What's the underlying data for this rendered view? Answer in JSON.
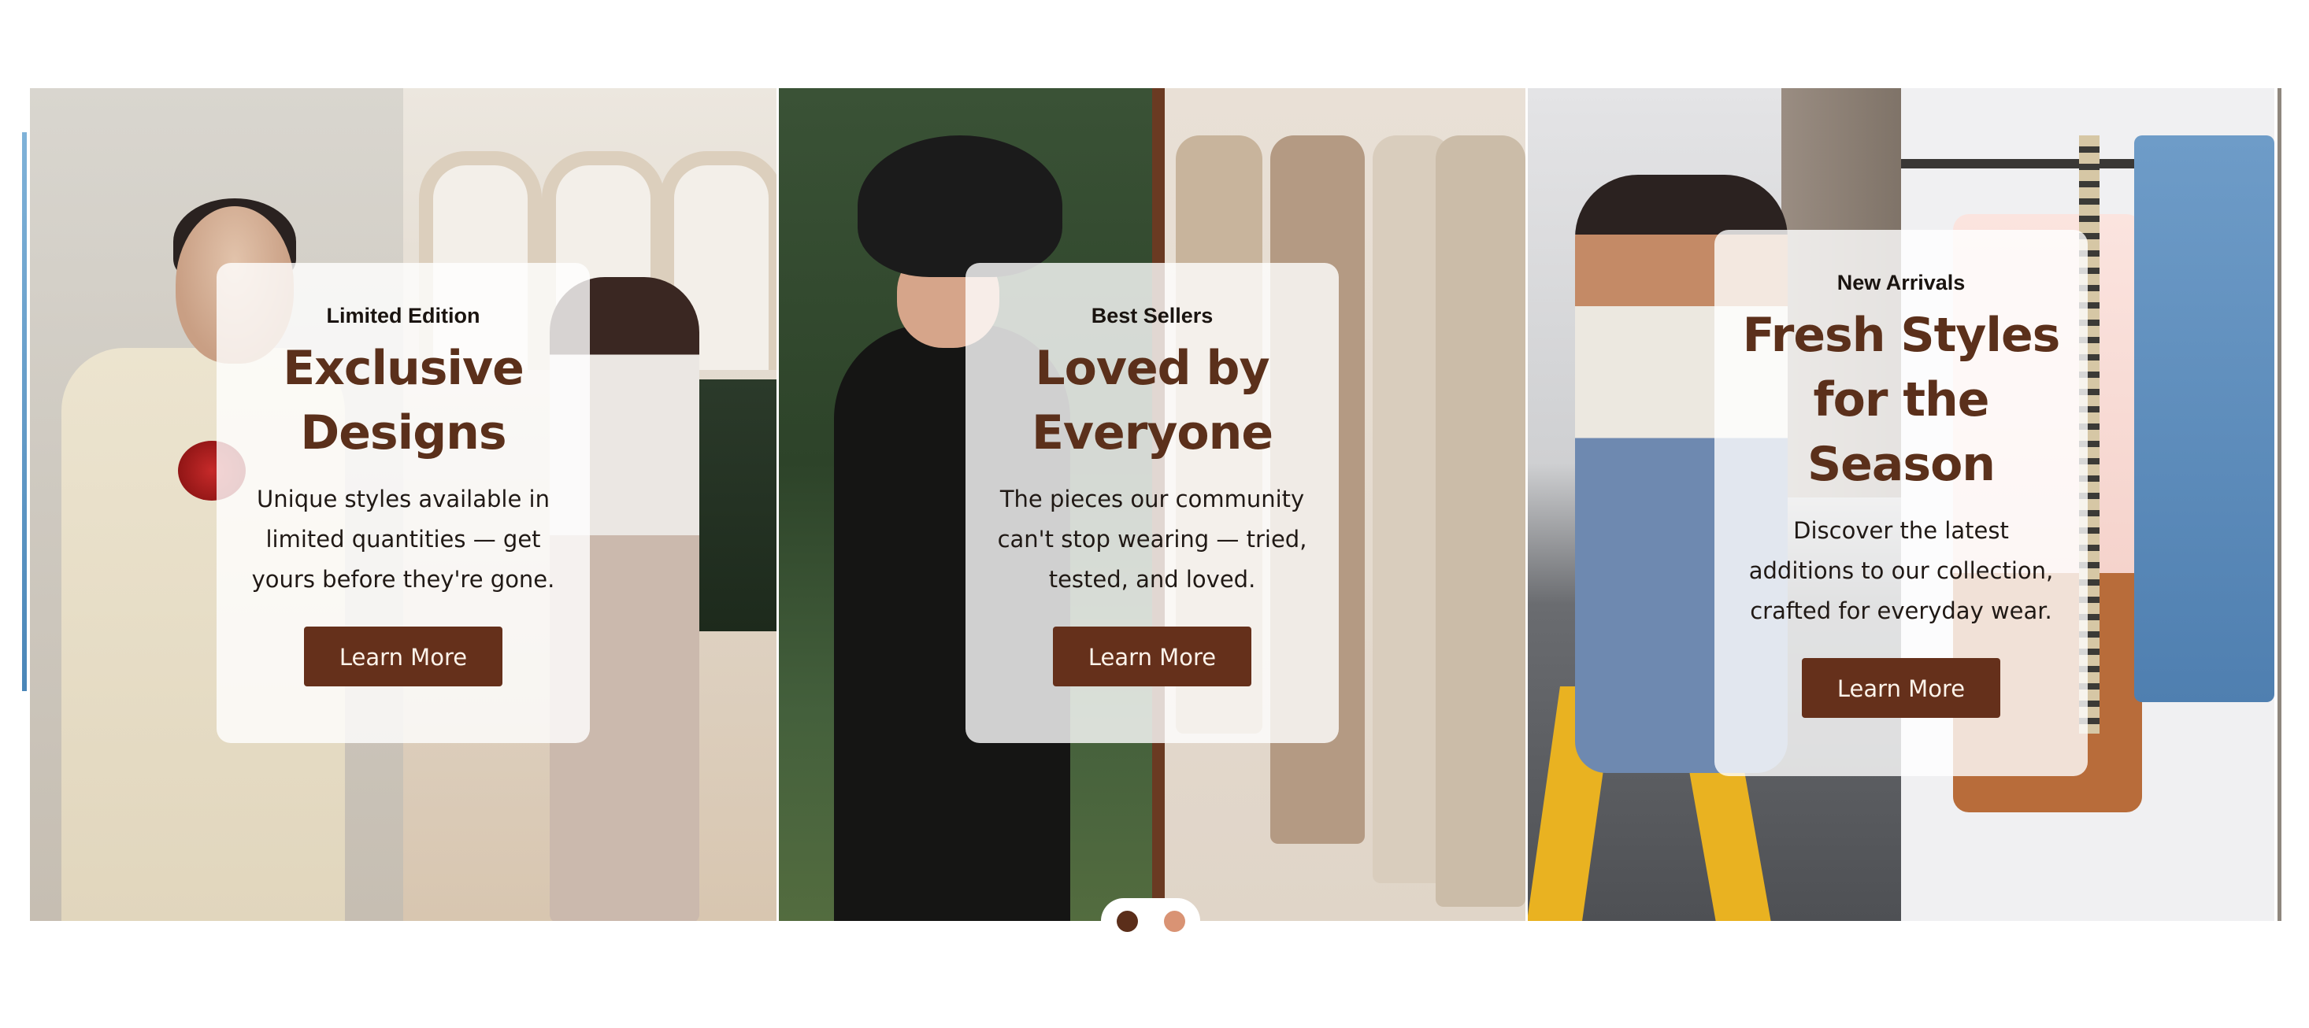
{
  "slides": [
    {
      "eyebrow": "Limited Edition",
      "heading": "Exclusive Designs",
      "description": "Unique styles available in limited quantities — get yours before they're gone.",
      "button_label": "Learn More"
    },
    {
      "eyebrow": "Best Sellers",
      "heading": "Loved by Everyone",
      "description": "The pieces our community can't stop wearing — tried, tested, and loved.",
      "button_label": "Learn More"
    },
    {
      "eyebrow": "New Arrivals",
      "heading": "Fresh Styles for the Season",
      "description": "Discover the latest additions to our collection, crafted for everyday wear.",
      "button_label": "Learn More"
    }
  ],
  "pagination": {
    "total": 2,
    "active": 1
  },
  "colors": {
    "accent": "#65301b",
    "heading": "#5b301b",
    "dot_active": "#5b2e1a",
    "dot_inactive": "#d99374"
  }
}
